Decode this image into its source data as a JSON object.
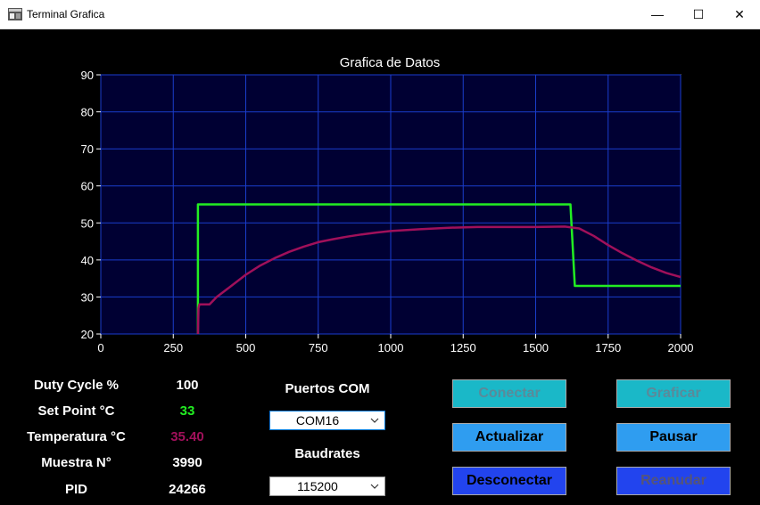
{
  "window": {
    "title": "Terminal Grafica",
    "minimize_glyph": "—",
    "maximize_glyph": "☐",
    "close_glyph": "✕"
  },
  "chart_data": {
    "type": "line",
    "title": "Grafica de Datos",
    "xlim": [
      0,
      2000
    ],
    "ylim": [
      20,
      90
    ],
    "x_ticks": [
      0,
      250,
      500,
      750,
      1000,
      1250,
      1500,
      1750,
      2000
    ],
    "y_ticks": [
      20,
      30,
      40,
      50,
      60,
      70,
      80,
      90
    ],
    "grid": true,
    "background": "#000033",
    "grid_color": "#1a3dcc",
    "series": [
      {
        "color": "#22ee22",
        "x": [
          335,
          335,
          1620,
          1635,
          2000
        ],
        "y": [
          20,
          55,
          55,
          33,
          33
        ]
      },
      {
        "color": "#a0105a",
        "x": [
          335,
          337,
          340,
          345,
          375,
          400,
          425,
          450,
          500,
          550,
          600,
          650,
          700,
          750,
          800,
          850,
          900,
          950,
          1000,
          1100,
          1200,
          1300,
          1400,
          1500,
          1600,
          1650,
          1700,
          1750,
          1800,
          1850,
          1900,
          1950,
          2000
        ],
        "y": [
          20,
          27,
          28,
          28,
          28,
          30,
          31.5,
          33,
          36,
          38.5,
          40.5,
          42.2,
          43.6,
          44.8,
          45.6,
          46.3,
          46.9,
          47.4,
          47.8,
          48.3,
          48.7,
          48.9,
          48.9,
          48.9,
          49,
          48.5,
          46.5,
          44,
          41.8,
          39.8,
          38,
          36.5,
          35.4
        ]
      }
    ]
  },
  "stats": {
    "duty_cycle": {
      "label": "Duty Cycle %",
      "value": "100",
      "value_color": "#ffffff"
    },
    "set_point": {
      "label": "Set Point °C",
      "value": "33",
      "value_color": "#22ee22"
    },
    "temperatura": {
      "label": "Temperatura °C",
      "value": "35.40",
      "value_color": "#a0105a"
    },
    "muestra": {
      "label": "Muestra N°",
      "value": "3990",
      "value_color": "#ffffff"
    },
    "pid": {
      "label": "PID",
      "value": "24266",
      "value_color": "#ffffff"
    }
  },
  "ports": {
    "com_label": "Puertos COM",
    "com_value": "COM16",
    "baud_label": "Baudrates",
    "baud_value": "115200"
  },
  "buttons": {
    "conectar": {
      "label": "Conectar",
      "bg": "#1ab8c8",
      "fg": "#5a8a9a"
    },
    "graficar": {
      "label": "Graficar",
      "bg": "#1ab8c8",
      "fg": "#5a8a9a"
    },
    "actualizar": {
      "label": "Actualizar",
      "bg": "#2f9df0",
      "fg": "#000000"
    },
    "pausar": {
      "label": "Pausar",
      "bg": "#2f9df0",
      "fg": "#000000"
    },
    "desconectar": {
      "label": "Desconectar",
      "bg": "#2244ee",
      "fg": "#000000"
    },
    "reanudar": {
      "label": "Reanudar",
      "bg": "#2244ee",
      "fg": "#555577"
    }
  }
}
